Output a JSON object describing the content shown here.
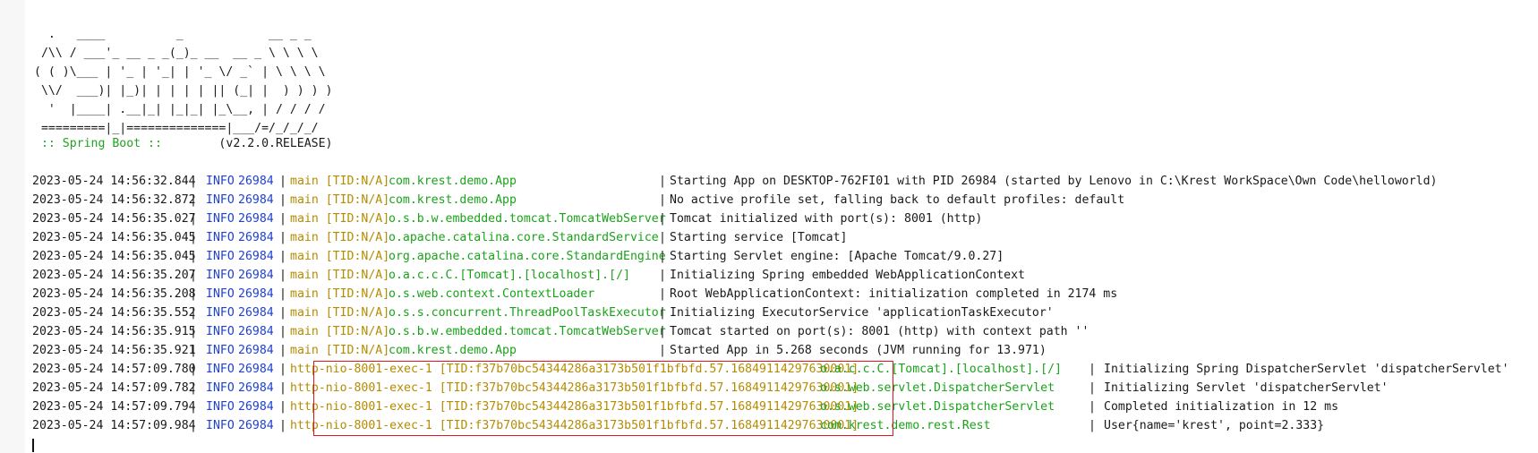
{
  "banner": {
    "ascii_art": "  .   ____          _            __ _ _\n /\\\\ / ___'_ __ _ _(_)_ __  __ _ \\ \\ \\ \\\n( ( )\\___ | '_ | '_| | '_ \\/ _` | \\ \\ \\ \\\n \\\\/  ___)| |_)| | | | | || (_| |  ) ) ) )\n  '  |____| .__|_| |_|_| |_\\__, | / / / /\n =========|_|==============|___/=/_/_/_/",
    "spring_label": " :: Spring Boot :: ",
    "version": "       (v2.2.0.RELEASE)"
  },
  "logs": [
    {
      "ts": "2023-05-24 14:56:32.844",
      "level": "INFO",
      "pid": "26984",
      "thread": "main [TID:N/A]",
      "logger": "com.krest.demo.App",
      "msg": "Starting App on DESKTOP-762FI01 with PID 26984 (started by Lenovo in C:\\Krest WorkSpace\\Own Code\\helloworld)"
    },
    {
      "ts": "2023-05-24 14:56:32.872",
      "level": "INFO",
      "pid": "26984",
      "thread": "main [TID:N/A]",
      "logger": "com.krest.demo.App",
      "msg": "No active profile set, falling back to default profiles: default"
    },
    {
      "ts": "2023-05-24 14:56:35.027",
      "level": "INFO",
      "pid": "26984",
      "thread": "main [TID:N/A]",
      "logger": "o.s.b.w.embedded.tomcat.TomcatWebServer",
      "msg": "Tomcat initialized with port(s): 8001 (http)"
    },
    {
      "ts": "2023-05-24 14:56:35.045",
      "level": "INFO",
      "pid": "26984",
      "thread": "main [TID:N/A]",
      "logger": "o.apache.catalina.core.StandardService",
      "msg": "Starting service [Tomcat]"
    },
    {
      "ts": "2023-05-24 14:56:35.045",
      "level": "INFO",
      "pid": "26984",
      "thread": "main [TID:N/A]",
      "logger": "org.apache.catalina.core.StandardEngine",
      "msg": "Starting Servlet engine: [Apache Tomcat/9.0.27]"
    },
    {
      "ts": "2023-05-24 14:56:35.207",
      "level": "INFO",
      "pid": "26984",
      "thread": "main [TID:N/A]",
      "logger": "o.a.c.c.C.[Tomcat].[localhost].[/]",
      "msg": "Initializing Spring embedded WebApplicationContext"
    },
    {
      "ts": "2023-05-24 14:56:35.208",
      "level": "INFO",
      "pid": "26984",
      "thread": "main [TID:N/A]",
      "logger": "o.s.web.context.ContextLoader",
      "msg": "Root WebApplicationContext: initialization completed in 2174 ms"
    },
    {
      "ts": "2023-05-24 14:56:35.552",
      "level": "INFO",
      "pid": "26984",
      "thread": "main [TID:N/A]",
      "logger": "o.s.s.concurrent.ThreadPoolTaskExecutor",
      "msg": "Initializing ExecutorService 'applicationTaskExecutor'"
    },
    {
      "ts": "2023-05-24 14:56:35.915",
      "level": "INFO",
      "pid": "26984",
      "thread": "main [TID:N/A]",
      "logger": "o.s.b.w.embedded.tomcat.TomcatWebServer",
      "msg": "Tomcat started on port(s): 8001 (http) with context path ''"
    },
    {
      "ts": "2023-05-24 14:56:35.921",
      "level": "INFO",
      "pid": "26984",
      "thread": "main [TID:N/A]",
      "logger": "com.krest.demo.App",
      "msg": "Started App in 5.268 seconds (JVM running for 13.971)"
    },
    {
      "ts": "2023-05-24 14:57:09.780",
      "level": "INFO",
      "pid": "26984",
      "thread": "http-nio-8001-exec-1 [TID:f37b70bc54344286a3173b501f1bfbfd.57.16849114297630001]",
      "logger": "o.a.c.c.C.[Tomcat].[localhost].[/]",
      "msg": "Initializing Spring DispatcherServlet 'dispatcherServlet'"
    },
    {
      "ts": "2023-05-24 14:57:09.782",
      "level": "INFO",
      "pid": "26984",
      "thread": "http-nio-8001-exec-1 [TID:f37b70bc54344286a3173b501f1bfbfd.57.16849114297630001]",
      "logger": "o.s.web.servlet.DispatcherServlet",
      "msg": "Initializing Servlet 'dispatcherServlet'"
    },
    {
      "ts": "2023-05-24 14:57:09.794",
      "level": "INFO",
      "pid": "26984",
      "thread": "http-nio-8001-exec-1 [TID:f37b70bc54344286a3173b501f1bfbfd.57.16849114297630001]",
      "logger": "o.s.web.servlet.DispatcherServlet",
      "msg": "Completed initialization in 12 ms"
    },
    {
      "ts": "2023-05-24 14:57:09.984",
      "level": "INFO",
      "pid": "26984",
      "thread": "http-nio-8001-exec-1 [TID:f37b70bc54344286a3173b501f1bfbfd.57.16849114297630001]",
      "logger": "com.krest.demo.rest.Rest",
      "msg": "User{name='krest', point=2.333}"
    }
  ],
  "colors": {
    "level": "#1e40d8",
    "thread": "#b58b00",
    "logger": "#1aa31a",
    "highlight_box": "#e0161e",
    "spring_label": "#22a322"
  }
}
